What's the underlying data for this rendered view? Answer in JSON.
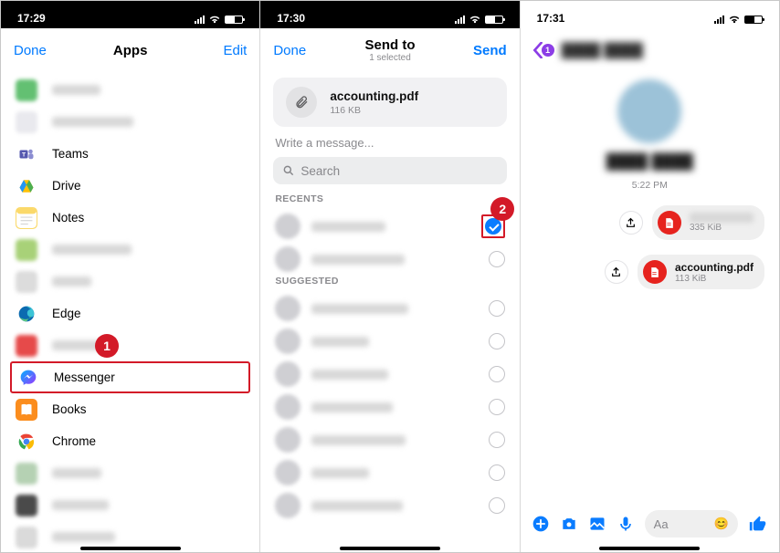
{
  "screens": {
    "s1": {
      "time": "17:29",
      "done": "Done",
      "title": "Apps",
      "edit": "Edit",
      "apps": [
        {
          "label": "",
          "blurred": true,
          "iconBg": "#63c072"
        },
        {
          "label": "",
          "blurred": true,
          "iconBg": "#e9e9ee"
        },
        {
          "label": "Teams",
          "blurred": false,
          "iconBg": "#ffffff",
          "iconFg": "#5558af"
        },
        {
          "label": "Drive",
          "blurred": false,
          "iconBg": "#ffffff"
        },
        {
          "label": "Notes",
          "blurred": false,
          "iconBg": "#fbd96a"
        },
        {
          "label": "",
          "blurred": true,
          "iconBg": "#a8d178"
        },
        {
          "label": "",
          "blurred": true,
          "iconBg": "#dcdcdc"
        },
        {
          "label": "Edge",
          "blurred": false,
          "iconBg": "#ffffff"
        },
        {
          "label": "",
          "blurred": true,
          "iconBg": "#e64a4a"
        },
        {
          "label": "Messenger",
          "blurred": false,
          "iconBg": "#ffffff",
          "selected": true
        },
        {
          "label": "Books",
          "blurred": false,
          "iconBg": "#fb8d1e"
        },
        {
          "label": "Chrome",
          "blurred": false,
          "iconBg": "#ffffff"
        },
        {
          "label": "",
          "blurred": true,
          "iconBg": "#b5d1b3"
        },
        {
          "label": "",
          "blurred": true,
          "iconBg": "#4a4a4a"
        },
        {
          "label": "",
          "blurred": true,
          "iconBg": "#dadada"
        }
      ],
      "callout": "1"
    },
    "s2": {
      "time": "17:30",
      "done": "Done",
      "title": "Send to",
      "subtitle": "1 selected",
      "send": "Send",
      "file": {
        "name": "accounting.pdf",
        "size": "116 KB"
      },
      "msg_placeholder": "Write a message...",
      "search_placeholder": "Search",
      "recents_label": "RECENTS",
      "suggested_label": "SUGGESTED",
      "recents": [
        {
          "selected": true
        },
        {
          "selected": false
        }
      ],
      "suggested": [
        {},
        {},
        {},
        {},
        {},
        {},
        {}
      ],
      "callout": "2"
    },
    "s3": {
      "time": "17:31",
      "back_badge": "1",
      "chat_time": "5:22 PM",
      "messages": [
        {
          "name_blurred": true,
          "size": "335 KiB"
        },
        {
          "name": "accounting.pdf",
          "size": "113 KiB"
        }
      ],
      "composer_placeholder": "Aa"
    }
  }
}
